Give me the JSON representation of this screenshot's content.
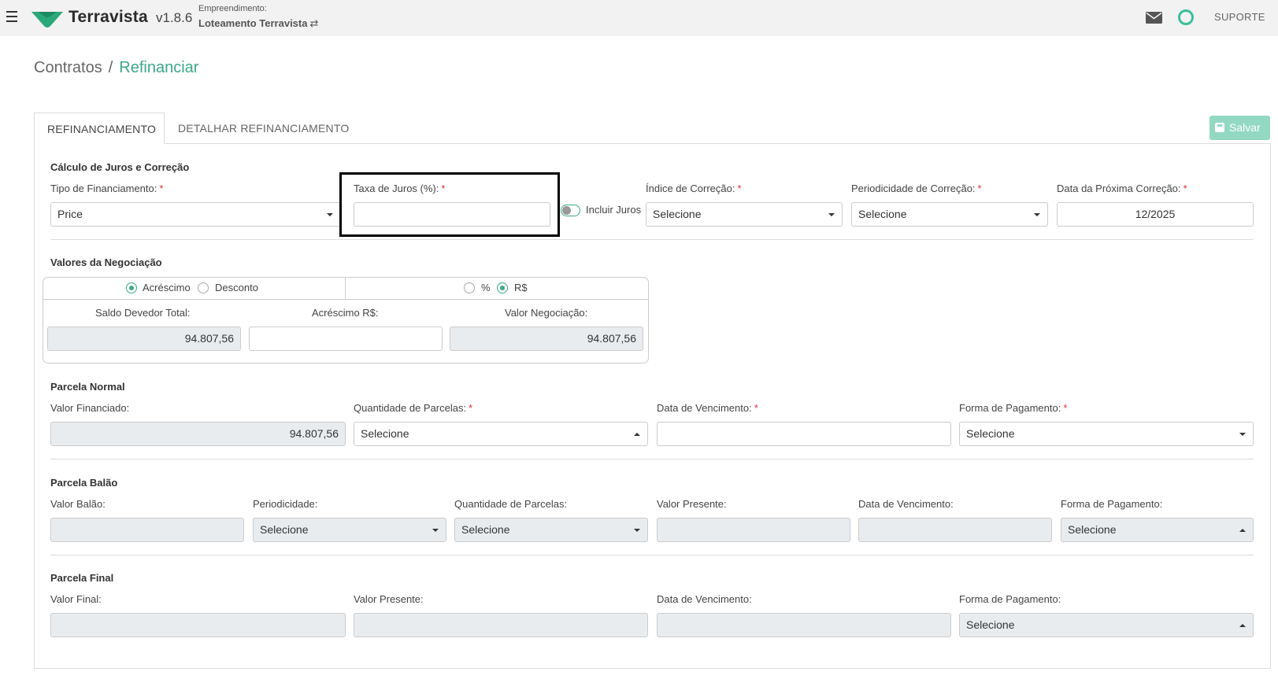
{
  "header": {
    "brand": "Terravista",
    "version": "v1.8.6",
    "empreendimento_label": "Empreendimento:",
    "empreendimento_name": "Loteamento Terravista",
    "swap_symbol": "⇄",
    "support": "SUPORTE"
  },
  "breadcrumb": {
    "root": "Contratos",
    "separator": "/",
    "current": "Refinanciar"
  },
  "tabs": [
    {
      "label": "REFINANCIAMENTO",
      "active": true
    },
    {
      "label": "DETALHAR REFINANCIAMENTO",
      "active": false
    }
  ],
  "save_label": "Salvar",
  "calculo": {
    "title": "Cálculo de Juros e Correção",
    "tipo_label": "Tipo de Financiamento:",
    "tipo_value": "Price",
    "taxa_label": "Taxa de Juros (%):",
    "taxa_value": "",
    "incluir_juros_label": "Incluir Juros",
    "incluir_juros_on": false,
    "indice_label": "Índice de Correção:",
    "indice_value": "Selecione",
    "periodicidade_label": "Periodicidade de Correção:",
    "periodicidade_value": "Selecione",
    "data_label": "Data da Próxima Correção:",
    "data_value": "12/2025",
    "required_mark": "*"
  },
  "negociacao": {
    "title": "Valores da Negociação",
    "acrescimo_label": "Acréscimo",
    "desconto_label": "Desconto",
    "percent_label": "%",
    "reais_label": "R$",
    "selected_tipo": "Acréscimo",
    "selected_unidade": "R$",
    "saldo_label": "Saldo Devedor Total:",
    "saldo_value": "94.807,56",
    "acrescimo_rs_label": "Acréscimo R$:",
    "acrescimo_rs_value": "",
    "valor_label": "Valor Negociação:",
    "valor_value": "94.807,56"
  },
  "parcela_normal": {
    "title": "Parcela Normal",
    "valor_label": "Valor Financiado:",
    "valor_value": "94.807,56",
    "quantidade_label": "Quantidade de Parcelas:",
    "quantidade_value": "Selecione",
    "vencimento_label": "Data de Vencimento:",
    "vencimento_value": "",
    "forma_label": "Forma de Pagamento:",
    "forma_value": "Selecione"
  },
  "parcela_balao": {
    "title": "Parcela Balão",
    "valor_label": "Valor Balão:",
    "periodicidade_label": "Periodicidade:",
    "periodicidade_value": "Selecione",
    "quantidade_label": "Quantidade de Parcelas:",
    "quantidade_value": "Selecione",
    "presente_label": "Valor Presente:",
    "vencimento_label": "Data de Vencimento:",
    "forma_label": "Forma de Pagamento:",
    "forma_value": "Selecione"
  },
  "parcela_final": {
    "title": "Parcela Final",
    "valor_label": "Valor Final:",
    "presente_label": "Valor Presente:",
    "vencimento_label": "Data de Vencimento:",
    "forma_label": "Forma de Pagamento:",
    "forma_value": "Selecione"
  },
  "colors": {
    "accent": "#3ba886",
    "save_button": "#93d8c2",
    "required": "#dd3333",
    "disabled_field": "#e9ecef"
  }
}
